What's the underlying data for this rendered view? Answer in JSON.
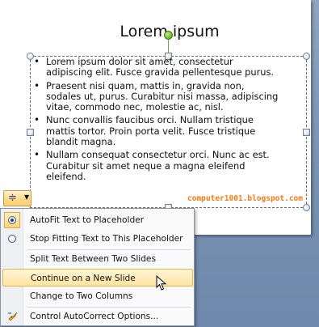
{
  "slide": {
    "title": "Lorem ipsum",
    "bullets": [
      "Lorem ipsum dolor sit amet, consectetur\nadipiscing elit. Fusce gravida pellentesque purus.",
      "Praesent nisi quam, mattis in, gravida non,\nsodales ut, purus. Curabitur nisi massa, adipiscing\nvitae, commodo nec, molestie ac, nisl.",
      "Nunc convallis faucibus orci. Nullam tristique\nmattis tortor. Proin porta velit. Fusce tristique\nblandit magna.",
      "Nullam consequat consectetur orci. Nunc ac est.\nCurabitur sit amet neque a magna eleifend\neleifend."
    ],
    "watermark": "computer1001.blogspot.com"
  },
  "autofit_button": {
    "icon": "autofit-options-icon"
  },
  "menu": {
    "items": [
      {
        "label": "AutoFit Text to Placeholder",
        "icon": "radio-icon",
        "checked": true
      },
      {
        "label": "Stop Fitting Text to This Placeholder",
        "icon": "radio-icon",
        "checked": false
      },
      {
        "label": "Split Text Between Two Slides"
      },
      {
        "label": "Continue on a New Slide",
        "hovered": true
      },
      {
        "label": "Change to Two Columns"
      },
      {
        "label": "Control AutoCorrect Options...",
        "icon": "lightning-icon"
      }
    ]
  },
  "colors": {
    "accent_hover": "#ffe3a0",
    "watermark": "#ff7a12",
    "backdrop": "#7f96b5"
  }
}
